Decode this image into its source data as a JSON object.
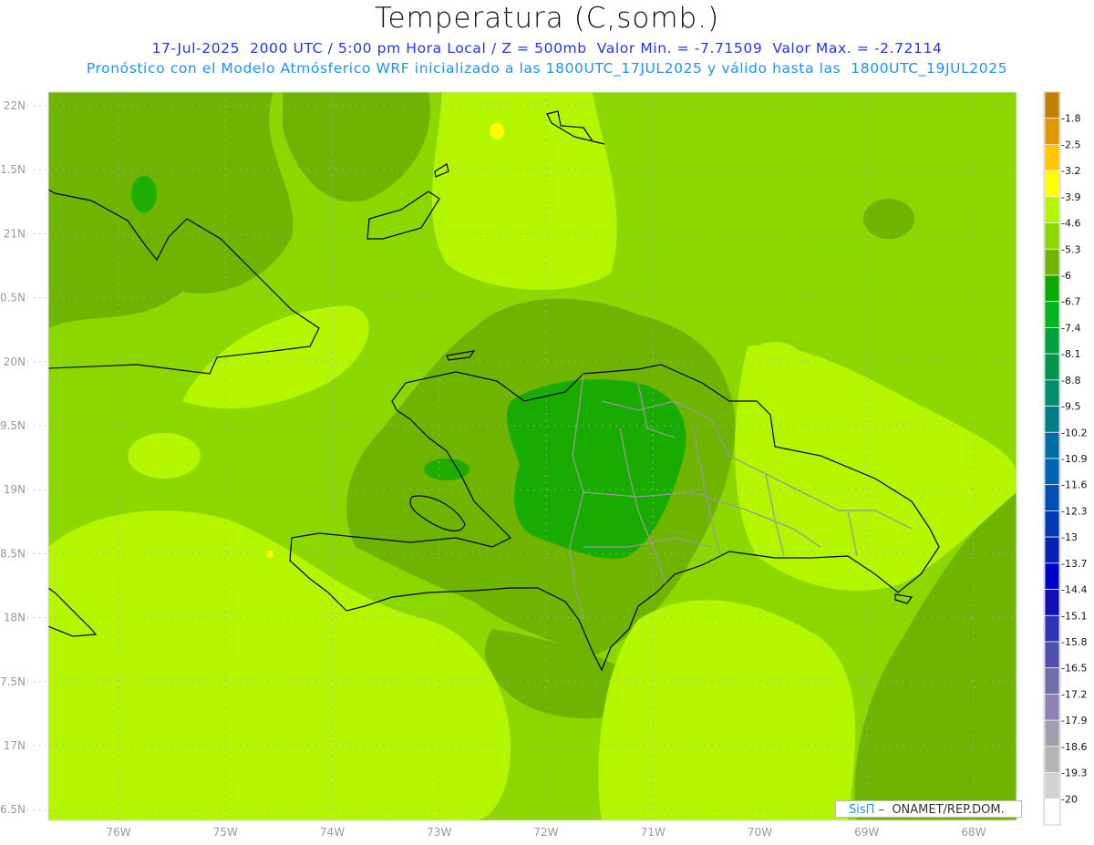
{
  "header": {
    "title": "Temperatura (C,somb.)",
    "line1": "17-Jul-2025  2000 UTC / 5:00 pm Hora Local / Z = 500mb  Valor Min. = -7.71509  Valor Max. = -2.72114",
    "line2": "Pronóstico con el Modelo Atmósferico WRF inicializado a las 1800UTC_17JUL2025 y válido hasta las  1800UTC_19JUL2025"
  },
  "axes": {
    "lon_labels": [
      "76W",
      "75W",
      "74W",
      "73W",
      "72W",
      "71W",
      "70W",
      "69W",
      "68W"
    ],
    "lat_labels": [
      "22N",
      "1.5N",
      "21N",
      "0.5N",
      "20N",
      "9.5N",
      "19N",
      "8.5N",
      "18N",
      "7.5N",
      "17N",
      "6.5N"
    ]
  },
  "colorbar": {
    "labels": [
      "-1.8",
      "-2.5",
      "-3.2",
      "-3.9",
      "-4.6",
      "-5.3",
      "-6",
      "-6.7",
      "-7.4",
      "-8.1",
      "-8.8",
      "-9.5",
      "-10.2",
      "-10.9",
      "-11.6",
      "-12.3",
      "-13",
      "-13.7",
      "-14.4",
      "-15.1",
      "-15.8",
      "-16.5",
      "-17.2",
      "-17.9",
      "-18.6",
      "-19.3",
      "-20"
    ],
    "colors": [
      "#c08000",
      "#e09800",
      "#ffc800",
      "#ffff00",
      "#b4f500",
      "#8cd700",
      "#6eb400",
      "#0aaa00",
      "#00b41e",
      "#00a03c",
      "#009650",
      "#008c6e",
      "#007d82",
      "#006ea0",
      "#0064b4",
      "#0050b4",
      "#0037b4",
      "#0023b4",
      "#0000c8",
      "#1010b4",
      "#3232b4",
      "#5050aa",
      "#6e6eaa",
      "#9080b4",
      "#a0a0aa",
      "#b4b4b4",
      "#d2d2d2",
      "#ffffff"
    ]
  },
  "credit": {
    "brand": "SisΠ",
    "text": " –  ONAMET/REP.DOM."
  },
  "map_colors": {
    "base": "#8cd700",
    "light": "#b4f500",
    "dark": "#6eb400",
    "darker": "#0aaa00",
    "yellow": "#ffff00"
  }
}
